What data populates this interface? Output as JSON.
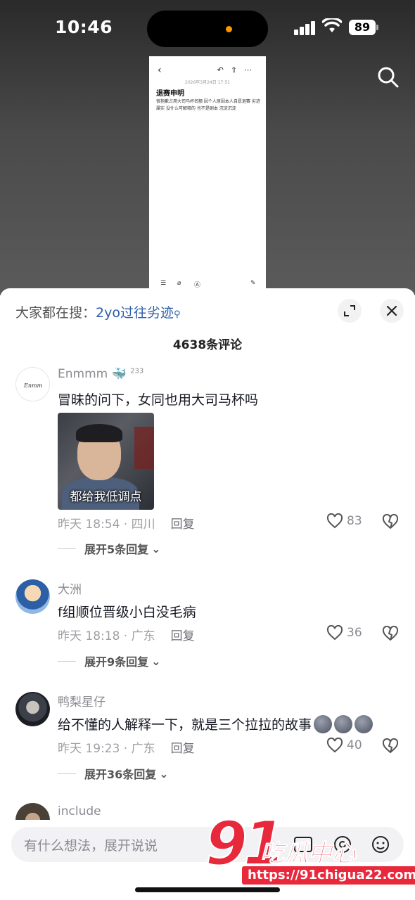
{
  "status": {
    "time": "10:46",
    "battery": "89"
  },
  "shot": {
    "date": "2026年3月24日 17:51",
    "title": "退赛申明",
    "body": "很抱歉占用大司马杯名额 因个人原因本人自愿退赛 劣迹属实 没什么可解释的 也不是剧本 沉淀沉淀"
  },
  "sheet": {
    "hot_prefix": "大家都在搜：",
    "hot_keyword": "2yo过往劣迹",
    "comment_count": "4638条评论"
  },
  "comments": [
    {
      "user": "Enmmm",
      "badge": "233",
      "text": "冒昧的问下，女同也用大司马杯吗",
      "image_caption": "都给我低调点",
      "time": "昨天 18:54 · 四川",
      "reply": "回复",
      "likes": "83",
      "expand": "展开5条回复"
    },
    {
      "user": "大洲",
      "text": "f组顺位晋级小白没毛病",
      "time": "昨天 18:18 · 广东",
      "reply": "回复",
      "likes": "36",
      "expand": "展开9条回复"
    },
    {
      "user": "鸭梨星仔",
      "text": "给不懂的人解释一下，就是三个拉拉的故事",
      "time": "昨天 19:23 · 广东",
      "reply": "回复",
      "likes": "40",
      "expand": "展开36条回复"
    },
    {
      "user": "include"
    }
  ],
  "input": {
    "placeholder": "有什么想法，展开说说"
  },
  "watermark": {
    "num": "91",
    "cn": "吃瓜中心",
    "url": "https://91chigua22.com"
  },
  "colors": {
    "accent_link": "#2b5ea8",
    "watermark_red": "#e8283b"
  }
}
